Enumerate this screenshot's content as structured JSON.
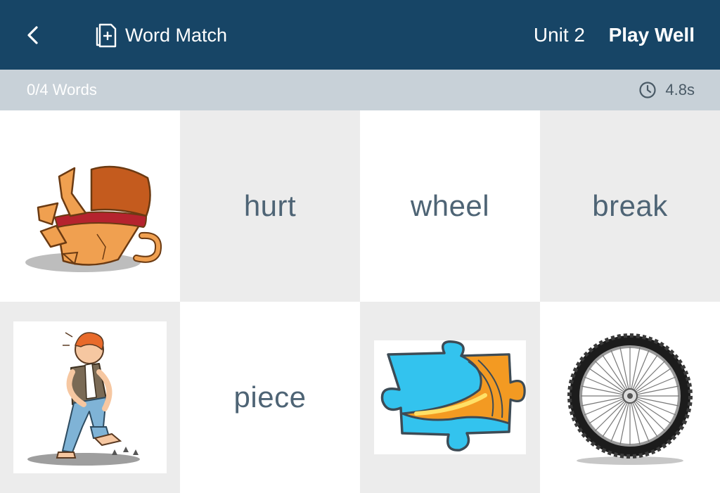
{
  "header": {
    "back_icon": "chevron-left-icon",
    "app_icon": "add-card-icon",
    "title": "Word Match",
    "unit": "Unit 2",
    "level": "Play Well"
  },
  "status": {
    "progress": "0/4 Words",
    "timer_icon": "clock-icon",
    "timer": "4.8s"
  },
  "tiles": [
    {
      "type": "image",
      "icon": "broken-cup-image"
    },
    {
      "type": "word",
      "label": "hurt"
    },
    {
      "type": "word",
      "label": "wheel"
    },
    {
      "type": "word",
      "label": "break"
    },
    {
      "type": "image",
      "icon": "hurt-foot-man-image"
    },
    {
      "type": "word",
      "label": "piece"
    },
    {
      "type": "image",
      "icon": "puzzle-piece-image"
    },
    {
      "type": "image",
      "icon": "bicycle-wheel-image"
    }
  ],
  "colors": {
    "header_bg": "#174566",
    "status_bg": "#c8d1d8",
    "tile_gray": "#ececec",
    "word_text": "#4e6475"
  }
}
